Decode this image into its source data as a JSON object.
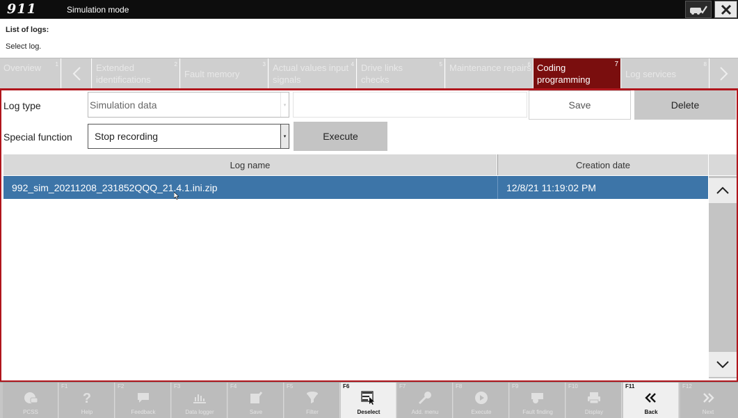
{
  "window": {
    "logo": "911",
    "mode": "Simulation mode"
  },
  "header": {
    "title": "List of logs:",
    "subtitle": "Select log."
  },
  "tabs": [
    {
      "label": "Overview",
      "num": "1"
    },
    {
      "label": "Extended identifications",
      "num": "2"
    },
    {
      "label": "Fault memory",
      "num": "3"
    },
    {
      "label": "Actual values input signals",
      "num": "4"
    },
    {
      "label": "Drive links checks",
      "num": "5"
    },
    {
      "label": "Maintenance repairs",
      "num": "6"
    },
    {
      "label": "Coding programming",
      "num": "7"
    },
    {
      "label": "Log services",
      "num": "8"
    }
  ],
  "form": {
    "log_type_label": "Log type",
    "log_type_value": "Simulation data",
    "special_function_label": "Special function",
    "special_function_value": "Stop recording",
    "save_label": "Save",
    "delete_label": "Delete",
    "execute_label": "Execute"
  },
  "table": {
    "columns": [
      "Log name",
      "Creation date"
    ],
    "rows": [
      {
        "name": "992_sim_20211208_231852QQQ_21.4.1.ini.zip",
        "date": "12/8/21 11:19:02 PM"
      }
    ]
  },
  "toolbar": [
    {
      "key": "",
      "label": "PCSS",
      "icon": "car-icon"
    },
    {
      "key": "F1",
      "label": "Help",
      "icon": "help-icon"
    },
    {
      "key": "F2",
      "label": "Feedback",
      "icon": "feedback-icon"
    },
    {
      "key": "F3",
      "label": "Data logger",
      "icon": "data-logger-icon"
    },
    {
      "key": "F4",
      "label": "Save",
      "icon": "save-icon"
    },
    {
      "key": "F5",
      "label": "Filter",
      "icon": "filter-icon"
    },
    {
      "key": "F6",
      "label": "Deselect",
      "icon": "deselect-icon"
    },
    {
      "key": "F7",
      "label": "Add. menu",
      "icon": "add-menu-icon"
    },
    {
      "key": "F8",
      "label": "Execute",
      "icon": "execute-icon"
    },
    {
      "key": "F9",
      "label": "Fault finding",
      "icon": "fault-finding-icon"
    },
    {
      "key": "F10",
      "label": "Display",
      "icon": "display-icon"
    },
    {
      "key": "F11",
      "label": "Back",
      "icon": "back-icon"
    },
    {
      "key": "F12",
      "label": "Next",
      "icon": "next-icon"
    }
  ],
  "colors": {
    "active_tab": "#7a0e0e",
    "frame_border": "#b0151c",
    "selected_row": "#3d75a8"
  }
}
